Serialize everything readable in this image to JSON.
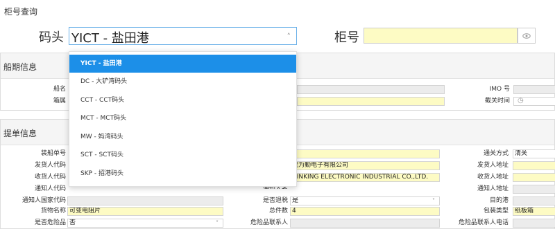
{
  "page_title": "柜号查询",
  "query": {
    "terminal_label": "码头",
    "terminal_value": "YICT - 盐田港",
    "cabinet_label": "柜号",
    "cabinet_value": ""
  },
  "dropdown_options": [
    "YICT - 盐田港",
    "DC - 大铲湾码头",
    "CCT - CCT码头",
    "MCT - MCT码头",
    "MW - 妈湾码头",
    "SCT - SCT码头",
    "SKP - 招港码头"
  ],
  "ship_section": {
    "title": "船期信息",
    "labels": {
      "ship_name": "船名",
      "cabinet_owner": "箱属",
      "imo": "IMO 号",
      "cutoff": "截关时间"
    }
  },
  "bill_section": {
    "title": "提单信息",
    "labels": {
      "vessel_bill_no": "装船单号",
      "shipper_code": "发货人代码",
      "consignee_code": "收货人代码",
      "notify_code": "通知人代码",
      "notify_country_code": "通知人国家代码",
      "goods_name": "货物名称",
      "is_dangerous": "是否危险品",
      "customs_mode": "通关方式",
      "shipper_addr": "发货人地址",
      "consignee_addr": "收货人地址",
      "notify_addr": "通知人地址",
      "destination": "目的港",
      "package_type": "包装类型",
      "danger_contact_phone": "危险品联系人电话",
      "notify_name_partial": "通知人名",
      "tax_refund": "是否退税",
      "total_pieces": "总件数",
      "danger_contact": "危险品联系人"
    },
    "values": {
      "customs_mode": "清关",
      "shipper_company": "莞为勤电子有限公司",
      "consignee_company": "HINKING ELECTRONIC INDUSTRIAL CO.,LTD.",
      "goods_name": "可变电阻片",
      "is_dangerous": "否",
      "tax_refund": "是",
      "total_pieces": "4",
      "package_type": "纸板箱"
    }
  },
  "colors": {
    "accent": "#1c8fe8",
    "required": "#fdfbc4",
    "readonly": "#ececec"
  },
  "icons": {
    "eye": "eye-icon",
    "clock": "clock-icon",
    "chevron": "chevron-down-icon"
  }
}
